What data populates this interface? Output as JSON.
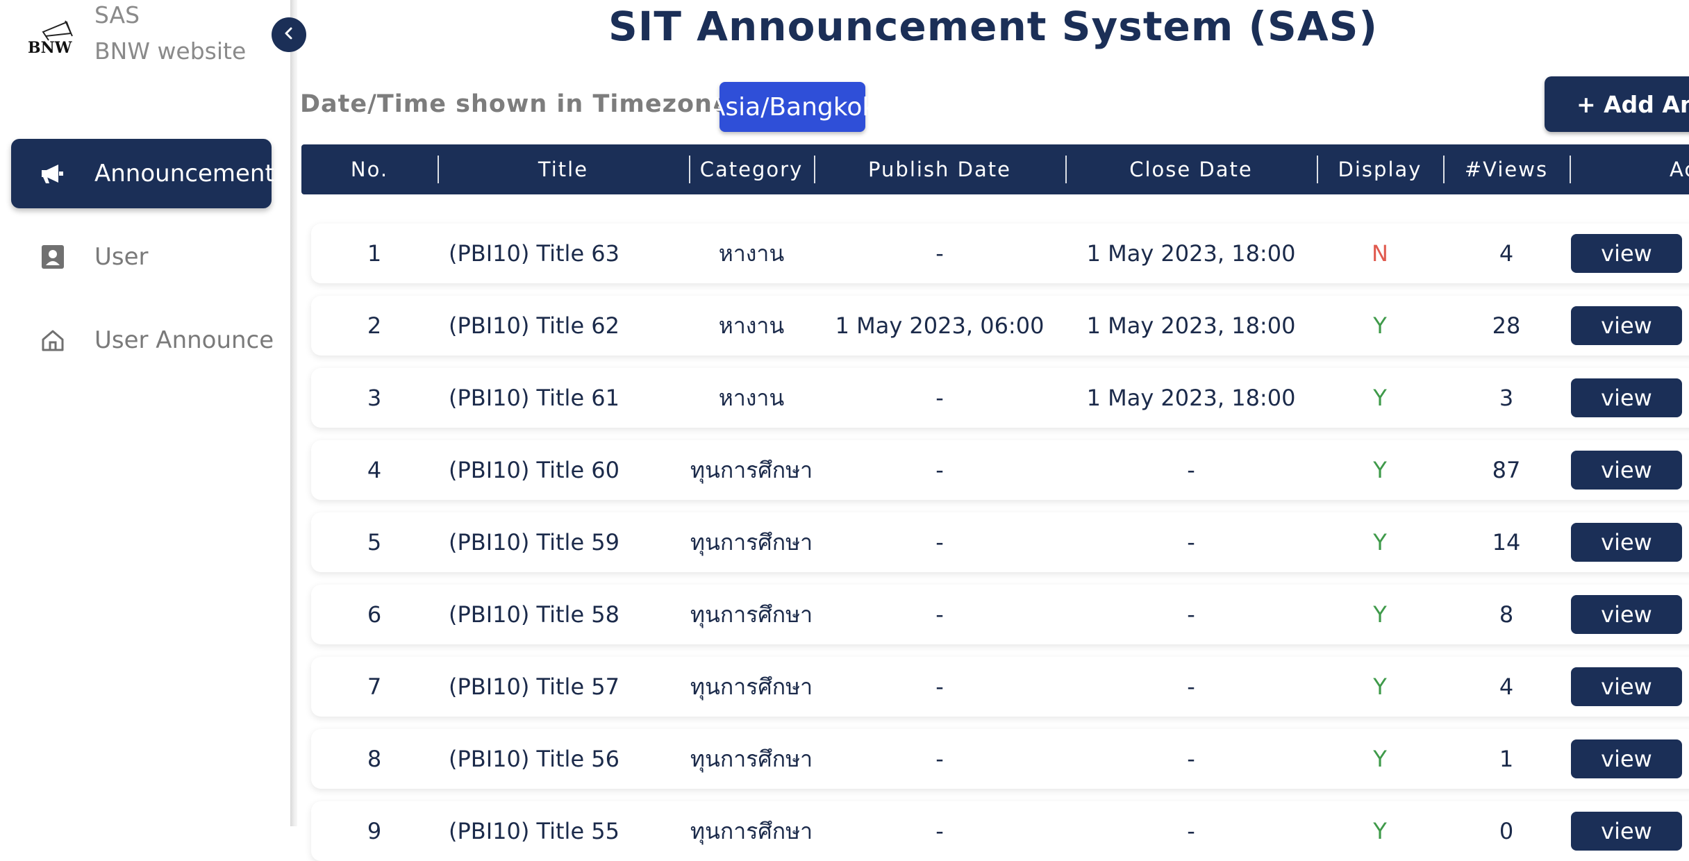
{
  "sidebar": {
    "brand_line1": "SAS",
    "brand_line2": "BNW website",
    "logo_text": "BNW",
    "items": [
      {
        "label": "Announcement",
        "icon": "megaphone-icon",
        "active": true
      },
      {
        "label": "User",
        "icon": "user-card-icon",
        "active": false
      },
      {
        "label": "User Announce",
        "icon": "home-icon",
        "active": false
      }
    ]
  },
  "header": {
    "title": "SIT Announcement System (SAS)",
    "tz_label": "Date/Time shown in Timezone:",
    "tz_value": "Asia/Bangkok",
    "add_label": "+ Add Announcement"
  },
  "table": {
    "columns": [
      "No.",
      "Title",
      "Category",
      "Publish Date",
      "Close Date",
      "Display",
      "#Views",
      "Action"
    ],
    "rows": [
      {
        "no": "1",
        "title": "(PBI10) Title 63",
        "category": "หางาน",
        "publish": "-",
        "close": "1 May 2023, 18:00",
        "display": "N",
        "views": "4",
        "action": "view"
      },
      {
        "no": "2",
        "title": "(PBI10) Title 62",
        "category": "หางาน",
        "publish": "1 May 2023, 06:00",
        "close": "1 May 2023, 18:00",
        "display": "Y",
        "views": "28",
        "action": "view"
      },
      {
        "no": "3",
        "title": "(PBI10) Title 61",
        "category": "หางาน",
        "publish": "-",
        "close": "1 May 2023, 18:00",
        "display": "Y",
        "views": "3",
        "action": "view"
      },
      {
        "no": "4",
        "title": "(PBI10) Title 60",
        "category": "ทุนการศึกษา",
        "publish": "-",
        "close": "-",
        "display": "Y",
        "views": "87",
        "action": "view"
      },
      {
        "no": "5",
        "title": "(PBI10) Title 59",
        "category": "ทุนการศึกษา",
        "publish": "-",
        "close": "-",
        "display": "Y",
        "views": "14",
        "action": "view"
      },
      {
        "no": "6",
        "title": "(PBI10) Title 58",
        "category": "ทุนการศึกษา",
        "publish": "-",
        "close": "-",
        "display": "Y",
        "views": "8",
        "action": "view"
      },
      {
        "no": "7",
        "title": "(PBI10) Title 57",
        "category": "ทุนการศึกษา",
        "publish": "-",
        "close": "-",
        "display": "Y",
        "views": "4",
        "action": "view"
      },
      {
        "no": "8",
        "title": "(PBI10) Title 56",
        "category": "ทุนการศึกษา",
        "publish": "-",
        "close": "-",
        "display": "Y",
        "views": "1",
        "action": "view"
      },
      {
        "no": "9",
        "title": "(PBI10) Title 55",
        "category": "ทุนการศึกษา",
        "publish": "-",
        "close": "-",
        "display": "Y",
        "views": "0",
        "action": "view"
      }
    ]
  },
  "colors": {
    "navy": "#1b2f57",
    "badge_blue": "#2f4fd8",
    "display_no": "#e05a4f",
    "display_yes": "#3f9a4a"
  }
}
